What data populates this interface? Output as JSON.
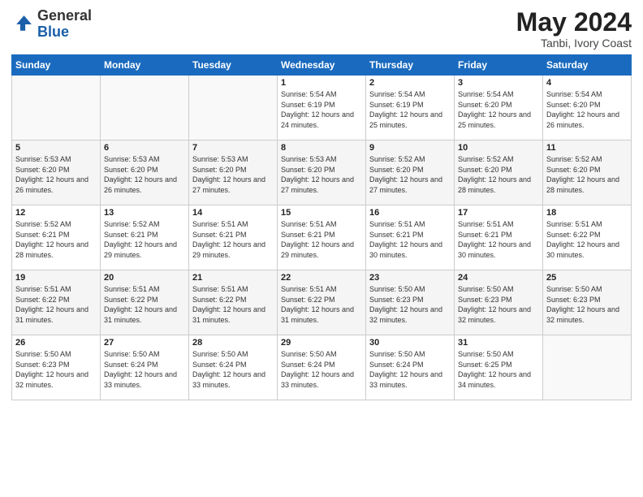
{
  "logo": {
    "general": "General",
    "blue": "Blue"
  },
  "header": {
    "month_year": "May 2024",
    "location": "Tanbi, Ivory Coast"
  },
  "weekdays": [
    "Sunday",
    "Monday",
    "Tuesday",
    "Wednesday",
    "Thursday",
    "Friday",
    "Saturday"
  ],
  "weeks": [
    [
      {
        "day": "",
        "sunrise": "",
        "sunset": "",
        "daylight": ""
      },
      {
        "day": "",
        "sunrise": "",
        "sunset": "",
        "daylight": ""
      },
      {
        "day": "",
        "sunrise": "",
        "sunset": "",
        "daylight": ""
      },
      {
        "day": "1",
        "sunrise": "Sunrise: 5:54 AM",
        "sunset": "Sunset: 6:19 PM",
        "daylight": "Daylight: 12 hours and 24 minutes."
      },
      {
        "day": "2",
        "sunrise": "Sunrise: 5:54 AM",
        "sunset": "Sunset: 6:19 PM",
        "daylight": "Daylight: 12 hours and 25 minutes."
      },
      {
        "day": "3",
        "sunrise": "Sunrise: 5:54 AM",
        "sunset": "Sunset: 6:20 PM",
        "daylight": "Daylight: 12 hours and 25 minutes."
      },
      {
        "day": "4",
        "sunrise": "Sunrise: 5:54 AM",
        "sunset": "Sunset: 6:20 PM",
        "daylight": "Daylight: 12 hours and 26 minutes."
      }
    ],
    [
      {
        "day": "5",
        "sunrise": "Sunrise: 5:53 AM",
        "sunset": "Sunset: 6:20 PM",
        "daylight": "Daylight: 12 hours and 26 minutes."
      },
      {
        "day": "6",
        "sunrise": "Sunrise: 5:53 AM",
        "sunset": "Sunset: 6:20 PM",
        "daylight": "Daylight: 12 hours and 26 minutes."
      },
      {
        "day": "7",
        "sunrise": "Sunrise: 5:53 AM",
        "sunset": "Sunset: 6:20 PM",
        "daylight": "Daylight: 12 hours and 27 minutes."
      },
      {
        "day": "8",
        "sunrise": "Sunrise: 5:53 AM",
        "sunset": "Sunset: 6:20 PM",
        "daylight": "Daylight: 12 hours and 27 minutes."
      },
      {
        "day": "9",
        "sunrise": "Sunrise: 5:52 AM",
        "sunset": "Sunset: 6:20 PM",
        "daylight": "Daylight: 12 hours and 27 minutes."
      },
      {
        "day": "10",
        "sunrise": "Sunrise: 5:52 AM",
        "sunset": "Sunset: 6:20 PM",
        "daylight": "Daylight: 12 hours and 28 minutes."
      },
      {
        "day": "11",
        "sunrise": "Sunrise: 5:52 AM",
        "sunset": "Sunset: 6:20 PM",
        "daylight": "Daylight: 12 hours and 28 minutes."
      }
    ],
    [
      {
        "day": "12",
        "sunrise": "Sunrise: 5:52 AM",
        "sunset": "Sunset: 6:21 PM",
        "daylight": "Daylight: 12 hours and 28 minutes."
      },
      {
        "day": "13",
        "sunrise": "Sunrise: 5:52 AM",
        "sunset": "Sunset: 6:21 PM",
        "daylight": "Daylight: 12 hours and 29 minutes."
      },
      {
        "day": "14",
        "sunrise": "Sunrise: 5:51 AM",
        "sunset": "Sunset: 6:21 PM",
        "daylight": "Daylight: 12 hours and 29 minutes."
      },
      {
        "day": "15",
        "sunrise": "Sunrise: 5:51 AM",
        "sunset": "Sunset: 6:21 PM",
        "daylight": "Daylight: 12 hours and 29 minutes."
      },
      {
        "day": "16",
        "sunrise": "Sunrise: 5:51 AM",
        "sunset": "Sunset: 6:21 PM",
        "daylight": "Daylight: 12 hours and 30 minutes."
      },
      {
        "day": "17",
        "sunrise": "Sunrise: 5:51 AM",
        "sunset": "Sunset: 6:21 PM",
        "daylight": "Daylight: 12 hours and 30 minutes."
      },
      {
        "day": "18",
        "sunrise": "Sunrise: 5:51 AM",
        "sunset": "Sunset: 6:22 PM",
        "daylight": "Daylight: 12 hours and 30 minutes."
      }
    ],
    [
      {
        "day": "19",
        "sunrise": "Sunrise: 5:51 AM",
        "sunset": "Sunset: 6:22 PM",
        "daylight": "Daylight: 12 hours and 31 minutes."
      },
      {
        "day": "20",
        "sunrise": "Sunrise: 5:51 AM",
        "sunset": "Sunset: 6:22 PM",
        "daylight": "Daylight: 12 hours and 31 minutes."
      },
      {
        "day": "21",
        "sunrise": "Sunrise: 5:51 AM",
        "sunset": "Sunset: 6:22 PM",
        "daylight": "Daylight: 12 hours and 31 minutes."
      },
      {
        "day": "22",
        "sunrise": "Sunrise: 5:51 AM",
        "sunset": "Sunset: 6:22 PM",
        "daylight": "Daylight: 12 hours and 31 minutes."
      },
      {
        "day": "23",
        "sunrise": "Sunrise: 5:50 AM",
        "sunset": "Sunset: 6:23 PM",
        "daylight": "Daylight: 12 hours and 32 minutes."
      },
      {
        "day": "24",
        "sunrise": "Sunrise: 5:50 AM",
        "sunset": "Sunset: 6:23 PM",
        "daylight": "Daylight: 12 hours and 32 minutes."
      },
      {
        "day": "25",
        "sunrise": "Sunrise: 5:50 AM",
        "sunset": "Sunset: 6:23 PM",
        "daylight": "Daylight: 12 hours and 32 minutes."
      }
    ],
    [
      {
        "day": "26",
        "sunrise": "Sunrise: 5:50 AM",
        "sunset": "Sunset: 6:23 PM",
        "daylight": "Daylight: 12 hours and 32 minutes."
      },
      {
        "day": "27",
        "sunrise": "Sunrise: 5:50 AM",
        "sunset": "Sunset: 6:24 PM",
        "daylight": "Daylight: 12 hours and 33 minutes."
      },
      {
        "day": "28",
        "sunrise": "Sunrise: 5:50 AM",
        "sunset": "Sunset: 6:24 PM",
        "daylight": "Daylight: 12 hours and 33 minutes."
      },
      {
        "day": "29",
        "sunrise": "Sunrise: 5:50 AM",
        "sunset": "Sunset: 6:24 PM",
        "daylight": "Daylight: 12 hours and 33 minutes."
      },
      {
        "day": "30",
        "sunrise": "Sunrise: 5:50 AM",
        "sunset": "Sunset: 6:24 PM",
        "daylight": "Daylight: 12 hours and 33 minutes."
      },
      {
        "day": "31",
        "sunrise": "Sunrise: 5:50 AM",
        "sunset": "Sunset: 6:25 PM",
        "daylight": "Daylight: 12 hours and 34 minutes."
      },
      {
        "day": "",
        "sunrise": "",
        "sunset": "",
        "daylight": ""
      }
    ]
  ]
}
